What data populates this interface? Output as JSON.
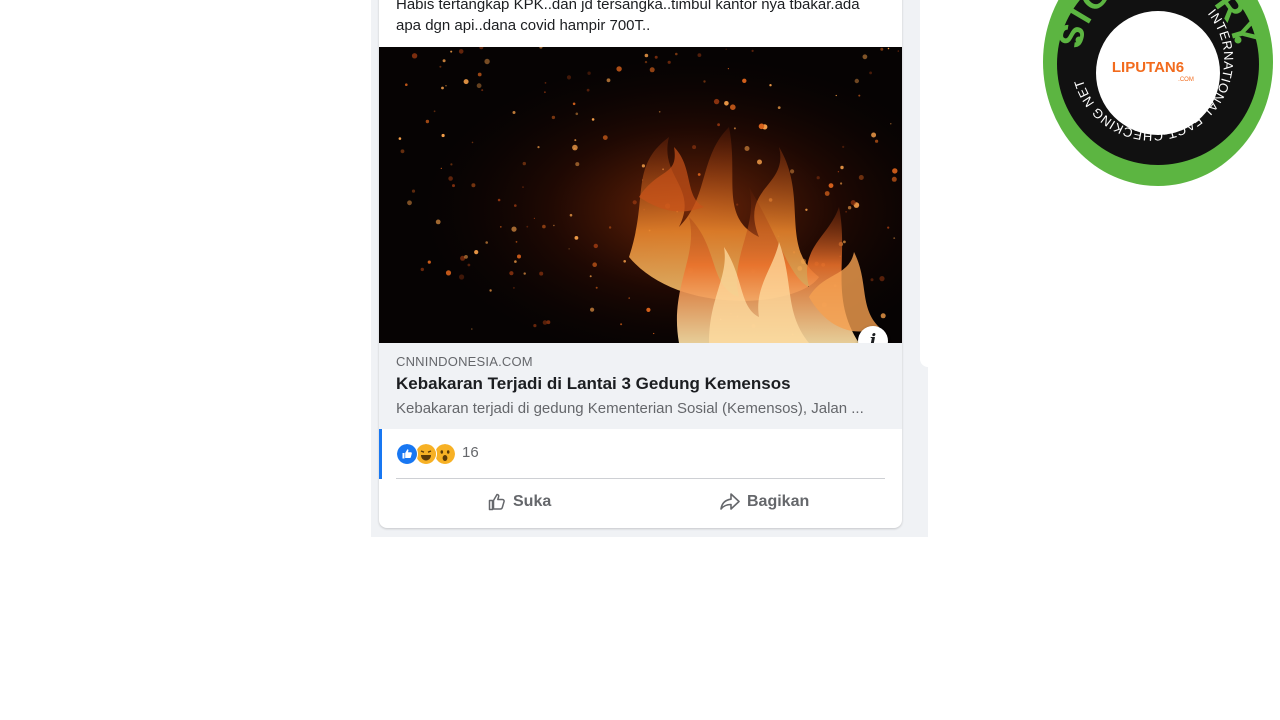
{
  "post": {
    "text": "Habis tertangkap KPK..dan jd tersangka..timbul kantor nya tbakar.ada\napa dgn api..dana covid hampir 700T..",
    "link": {
      "domain": "CNNINDONESIA.COM",
      "title": "Kebakaran Terjadi di Lantai 3 Gedung Kemensos",
      "description": "Kebakaran terjadi di gedung Kementerian Sosial (Kemensos), Jalan ..."
    },
    "reactions": {
      "icons": [
        "like-icon",
        "haha-icon",
        "wow-icon"
      ],
      "count": "16"
    },
    "actions": {
      "like_label": "Suka",
      "share_label": "Bagikan"
    },
    "info_icon": "info-icon"
  },
  "badge": {
    "ring_text_top": "SIGNATORY",
    "ring_text_bottom": "INTERNATIONAL FACT-CHECKING NETWORK",
    "logo_text": "LIPUTAN6",
    "logo_sub": ".COM",
    "colors": {
      "green": "#5cb541",
      "black": "#111111",
      "liputan": "#f26b1d"
    }
  },
  "colors": {
    "facebook_blue": "#1877f2",
    "text": "#1c1e21",
    "muted": "#65676b"
  }
}
